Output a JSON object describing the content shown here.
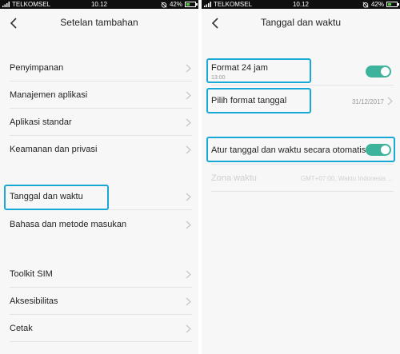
{
  "status_bar": {
    "carrier": "TELKOMSEL",
    "time": "10.12",
    "battery": "42%",
    "battery_level": 0.42,
    "icons": [
      "signal-icon",
      "alarm-off-icon",
      "battery-icon"
    ]
  },
  "left_screen": {
    "title": "Setelan tambahan",
    "items": [
      {
        "label": "Penyimpanan"
      },
      {
        "label": "Manajemen aplikasi"
      },
      {
        "label": "Aplikasi standar"
      },
      {
        "label": "Keamanan dan privasi"
      },
      {
        "label": "Tanggal dan waktu",
        "highlighted": true
      },
      {
        "label": "Bahasa dan metode masukan"
      },
      {
        "label": "Toolkit SIM"
      },
      {
        "label": "Aksesibilitas"
      },
      {
        "label": "Cetak"
      }
    ]
  },
  "right_screen": {
    "title": "Tanggal dan waktu",
    "format24": {
      "label": "Format 24 jam",
      "sub": "13:00",
      "toggle_on": true
    },
    "date_format": {
      "label": "Pilih format tanggal",
      "value": "31/12/2017"
    },
    "auto": {
      "label": "Atur tanggal dan waktu secara otomatis",
      "toggle_on": true
    },
    "timezone": {
      "label": "Zona waktu",
      "value": "GMT+07:00, Waktu Indonesia ...",
      "disabled": true
    }
  },
  "colors": {
    "highlight": "#18a8d8",
    "toggle_on": "#3cb39a",
    "background": "#f7f7f7"
  }
}
